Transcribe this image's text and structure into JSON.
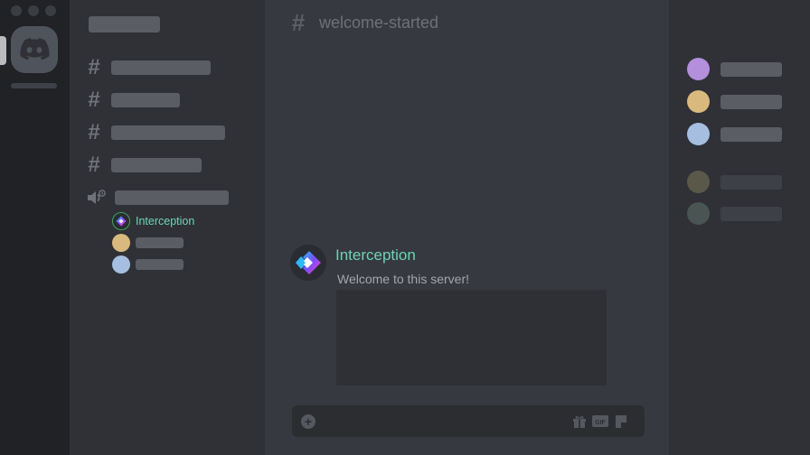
{
  "channel_header": {
    "name": "welcome-started"
  },
  "voice_channel": {
    "users": [
      {
        "name": "Interception",
        "avatar_color": "#2a2c31"
      },
      {
        "name": "",
        "avatar_color": "#d9b97e"
      },
      {
        "name": "",
        "avatar_color": "#a6bfe0"
      }
    ]
  },
  "message": {
    "author": "Interception",
    "text": "Welcome to this server!",
    "author_color": "#6fd3b5"
  },
  "members": [
    {
      "avatar_color": "#b38fdc",
      "status": "online"
    },
    {
      "avatar_color": "#d9b97e",
      "status": "online"
    },
    {
      "avatar_color": "#a6bfe0",
      "status": "online"
    },
    {
      "avatar_color": "#5a5849",
      "status": "offline"
    },
    {
      "avatar_color": "#4a5452",
      "status": "offline"
    }
  ],
  "icons": [
    "discord-icon",
    "hash-icon",
    "speaker-icon",
    "plus-icon",
    "gift-icon",
    "gif-icon",
    "sticker-icon"
  ]
}
